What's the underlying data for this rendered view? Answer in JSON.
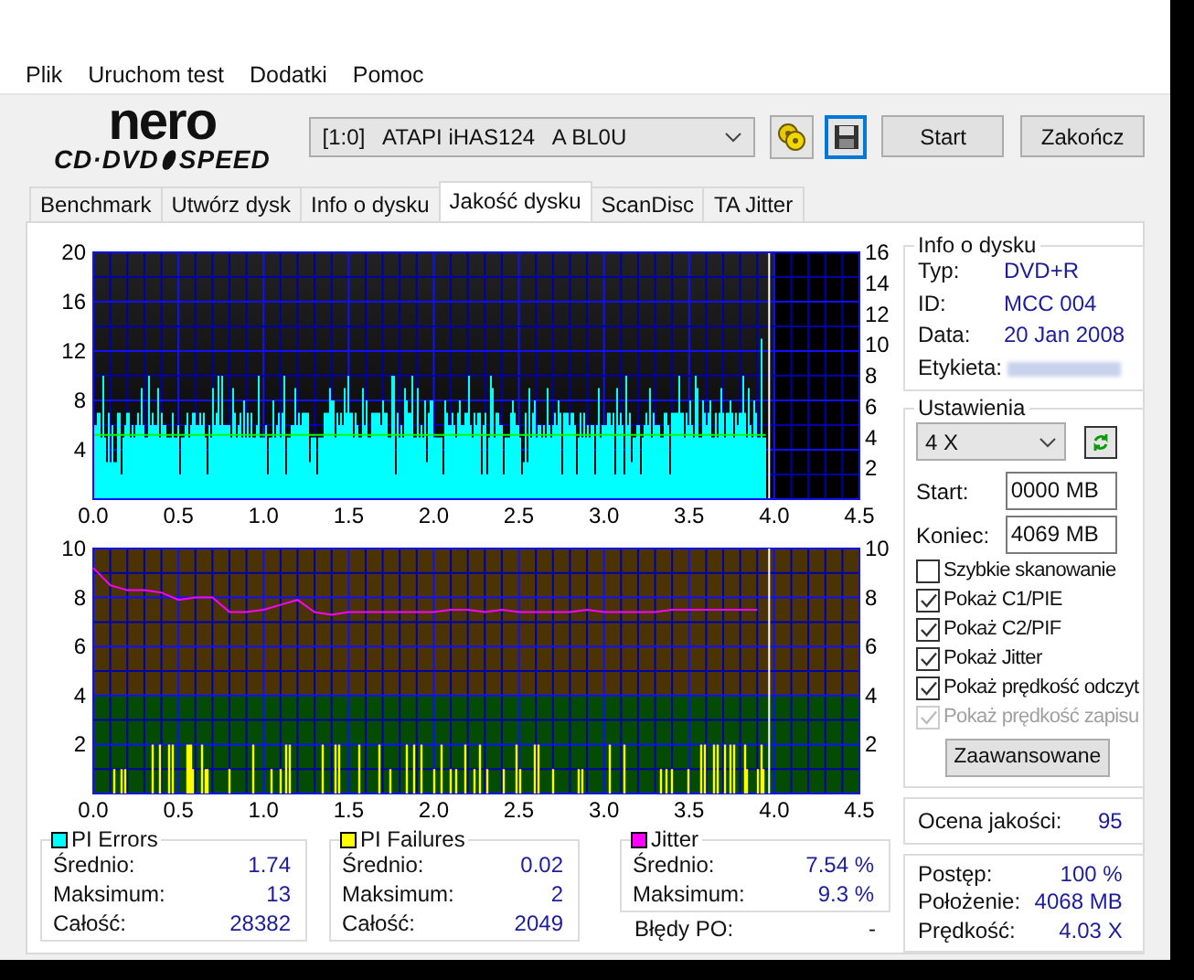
{
  "menu": [
    "Plik",
    "Uruchom test",
    "Dodatki",
    "Pomoc"
  ],
  "logo": {
    "brand": "nero",
    "left": "CD·DVD",
    "right": "SPEED"
  },
  "drive": {
    "value": "[1:0]   ATAPI iHAS124   A BL0U"
  },
  "buttons": [
    "Start",
    "Zakończ"
  ],
  "tabs": [
    {
      "label": "Benchmark",
      "selected": false
    },
    {
      "label": "Utwórz dysk",
      "selected": false
    },
    {
      "label": "Info o dysku",
      "selected": false
    },
    {
      "label": "Jakość dysku",
      "selected": true
    },
    {
      "label": "ScanDisc",
      "selected": false
    },
    {
      "label": "TA Jitter",
      "selected": false
    }
  ],
  "pi_chart": {
    "x_labels": [
      "0.0",
      "0.5",
      "1.0",
      "1.5",
      "2.0",
      "2.5",
      "3.0",
      "3.5",
      "4.0",
      "4.5"
    ],
    "left_labels": [
      "20",
      "16",
      "12",
      "8",
      "4"
    ],
    "right_labels": [
      "16",
      "14",
      "12",
      "10",
      "8",
      "6",
      "4",
      "2"
    ]
  },
  "jitter_chart": {
    "chart_data": {
      "type": "line",
      "xlim": [
        0,
        4.5
      ],
      "ylim": [
        0,
        10
      ],
      "x": [
        0,
        0.1,
        0.2,
        0.3,
        0.4,
        0.5,
        0.6,
        0.7,
        0.8,
        0.9,
        1.0,
        1.1,
        1.2,
        1.3,
        1.4,
        1.5,
        1.6,
        1.7,
        1.8,
        1.9,
        2.0,
        2.1,
        2.2,
        2.3,
        2.4,
        2.5,
        2.6,
        2.7,
        2.8,
        2.9,
        3.0,
        3.1,
        3.2,
        3.3,
        3.4,
        3.5,
        3.6,
        3.7,
        3.8,
        3.9
      ],
      "grid": true,
      "ref_lines": [
        {
          "axis": "x",
          "value": 3.97,
          "color": "#ffffff"
        }
      ],
      "series": [
        {
          "color": "#ff00ff",
          "values": [
            9.2,
            8.5,
            8.3,
            8.3,
            8.2,
            7.9,
            8.0,
            8.0,
            7.4,
            7.4,
            7.5,
            7.7,
            7.9,
            7.4,
            7.3,
            7.4,
            7.4,
            7.4,
            7.4,
            7.4,
            7.4,
            7.5,
            7.5,
            7.4,
            7.5,
            7.4,
            7.4,
            7.4,
            7.4,
            7.5,
            7.4,
            7.4,
            7.4,
            7.4,
            7.5,
            7.5,
            7.5,
            7.5,
            7.5,
            7.5
          ]
        }
      ],
      "xticks": [
        {
          "value": 0,
          "label": "0.0"
        },
        {
          "value": 0.5,
          "label": "0.5"
        },
        {
          "value": 1,
          "label": "1.0"
        },
        {
          "value": 1.5,
          "label": "1.5"
        },
        {
          "value": 2,
          "label": "2.0"
        },
        {
          "value": 2.5,
          "label": "2.5"
        },
        {
          "value": 3,
          "label": "3.0"
        },
        {
          "value": 3.5,
          "label": "3.5"
        },
        {
          "value": 4,
          "label": "4.0"
        },
        {
          "value": 4.5,
          "label": "4.5"
        }
      ],
      "yticks": [
        {
          "value": 10,
          "label": "10"
        },
        {
          "value": 8,
          "label": "8"
        },
        {
          "value": 6,
          "label": "6"
        },
        {
          "value": 4,
          "label": "4"
        },
        {
          "value": 2,
          "label": "2"
        }
      ]
    },
    "right_labels": [
      "10",
      "8",
      "6",
      "4",
      "2"
    ]
  },
  "disc_info": {
    "title": "Info o dysku",
    "fields": [
      {
        "label": "Typ:",
        "value": "DVD+R"
      },
      {
        "label": "ID:",
        "value": "MCC 004"
      },
      {
        "label": "Data:",
        "value": "20 Jan 2008"
      },
      {
        "label": "Etykieta:"
      }
    ]
  },
  "settings": {
    "title": "Ustawienia",
    "speed": "4 X",
    "start_label": "Start:",
    "start": "0000 MB",
    "end_label": "Koniec:",
    "end": "4069 MB",
    "options": [
      {
        "label": "Szybkie skanowanie",
        "checked": false,
        "disabled": false
      },
      {
        "label": "Pokaż C1/PIE",
        "checked": true,
        "disabled": false
      },
      {
        "label": "Pokaż C2/PIF",
        "checked": true,
        "disabled": false
      },
      {
        "label": "Pokaż Jitter",
        "checked": true,
        "disabled": false
      },
      {
        "label": "Pokaż prędkość odczyt",
        "checked": true,
        "disabled": false
      },
      {
        "label": "Pokaż prędkość zapisu",
        "checked": true,
        "disabled": true
      }
    ],
    "advanced": "Zaawansowane"
  },
  "quality": {
    "label": "Ocena jakości:",
    "value": "95"
  },
  "progress": [
    {
      "label": "Postęp:",
      "value": "100 %"
    },
    {
      "label": "Położenie:",
      "value": "4068 MB"
    },
    {
      "label": "Prędkość:",
      "value": "4.03 X"
    }
  ],
  "stats": [
    {
      "title": "PI Errors",
      "color": "#00ffff",
      "rows": [
        {
          "label": "Średnio:",
          "value": "1.74"
        },
        {
          "label": "Maksimum:",
          "value": "13"
        },
        {
          "label": "Całość:",
          "value": "28382"
        }
      ]
    },
    {
      "title": "PI Failures",
      "color": "#ffff00",
      "rows": [
        {
          "label": "Średnio:",
          "value": "0.02"
        },
        {
          "label": "Maksimum:",
          "value": "2"
        },
        {
          "label": "Całość:",
          "value": "2049"
        }
      ]
    },
    {
      "title": "Jitter",
      "color": "#ff00ff",
      "rows": [
        {
          "label": "Średnio:",
          "value": "7.54 %"
        },
        {
          "label": "Maksimum:",
          "value": "9.3 %"
        }
      ]
    }
  ],
  "errors_po": {
    "label": "Błędy PO:",
    "value": "-"
  }
}
